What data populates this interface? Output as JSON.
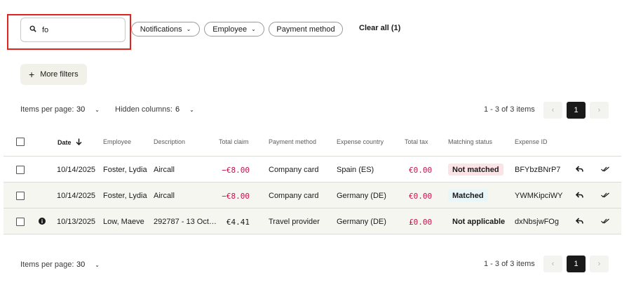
{
  "search": {
    "value": "fo",
    "placeholder": ""
  },
  "filters": {
    "notifications_label": "Notifications",
    "employee_label": "Employee",
    "payment_method_label": "Payment method",
    "clear_all_label": "Clear all (1)",
    "more_filters_label": "More filters"
  },
  "top_controls": {
    "items_per_page_label": "Items per page:",
    "items_per_page_value": "30",
    "hidden_columns_label": "Hidden columns:",
    "hidden_columns_value": "6",
    "range_text": "1 - 3 of 3 items",
    "current_page": "1"
  },
  "table": {
    "headers": {
      "date": "Date",
      "employee": "Employee",
      "description": "Description",
      "total_claim": "Total claim",
      "payment_method": "Payment method",
      "expense_country": "Expense country",
      "total_tax": "Total tax",
      "matching_status": "Matching status",
      "expense_id": "Expense ID"
    },
    "rows": [
      {
        "date": "10/14/2025",
        "employee": "Foster, Lydia",
        "description": "Aircall",
        "total_claim": "−€8.00",
        "payment_method": "Company card",
        "expense_country": "Spain (ES)",
        "total_tax": "€0.00",
        "matching_status": "Not matched",
        "expense_id": "BFYbzBNrP7"
      },
      {
        "date": "10/14/2025",
        "employee": "Foster, Lydia",
        "description": "Aircall",
        "total_claim": "−€8.00",
        "payment_method": "Company card",
        "expense_country": "Germany (DE)",
        "total_tax": "€0.00",
        "matching_status": "Matched",
        "expense_id": "YWMKipciWY"
      },
      {
        "date": "10/13/2025",
        "employee": "Low, Maeve",
        "description": "292787 - 13 Oct…",
        "total_claim": "€4.41",
        "payment_method": "Travel provider",
        "expense_country": "Germany (DE)",
        "total_tax": "£0.00",
        "matching_status": "Not applicable",
        "expense_id": "dxNbsjwFOg"
      }
    ]
  },
  "bottom_controls": {
    "items_per_page_label": "Items per page:",
    "items_per_page_value": "30",
    "range_text": "1 - 3 of 3 items",
    "current_page": "1"
  },
  "colors": {
    "accent_negative": "#c4124b",
    "highlight": "#e0231c",
    "active_page": "#1a1a1a"
  }
}
